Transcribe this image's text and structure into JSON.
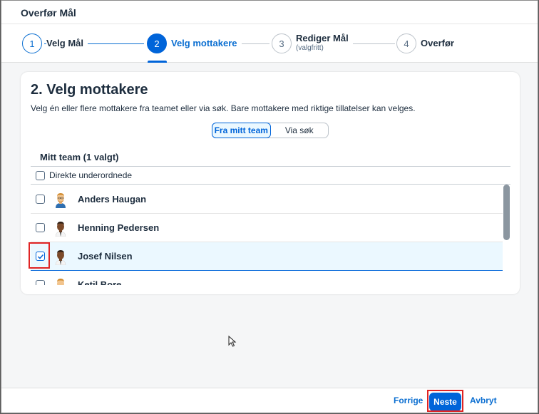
{
  "dialog": {
    "title": "Overfør Mål"
  },
  "wizard": {
    "steps": [
      {
        "number": "1",
        "label": "Velg Mål",
        "sublabel": ""
      },
      {
        "number": "2",
        "label": "Velg mottakere",
        "sublabel": ""
      },
      {
        "number": "3",
        "label": "Rediger Mål",
        "sublabel": "(valgfritt)"
      },
      {
        "number": "4",
        "label": "Overfør",
        "sublabel": ""
      }
    ]
  },
  "main": {
    "title": "2. Velg mottakere",
    "description": "Velg én eller flere mottakere fra teamet eller via søk. Bare mottakere med riktige tillatelser kan velges.",
    "segments": [
      "Fra mitt team",
      "Via søk"
    ],
    "team_title": "Mitt team (1 valgt)",
    "sub_header": "Direkte underordnede",
    "people": [
      {
        "name": "Anders Haugan",
        "checked": false
      },
      {
        "name": "Henning Pedersen",
        "checked": false
      },
      {
        "name": "Josef Nilsen",
        "checked": true
      },
      {
        "name": "Ketil Bore",
        "checked": false
      }
    ]
  },
  "footer": {
    "previous_label": "Forrige",
    "next_label": "Neste",
    "cancel_label": "Avbryt"
  },
  "colors": {
    "accent": "#0064d9",
    "highlight": "#e02424"
  }
}
